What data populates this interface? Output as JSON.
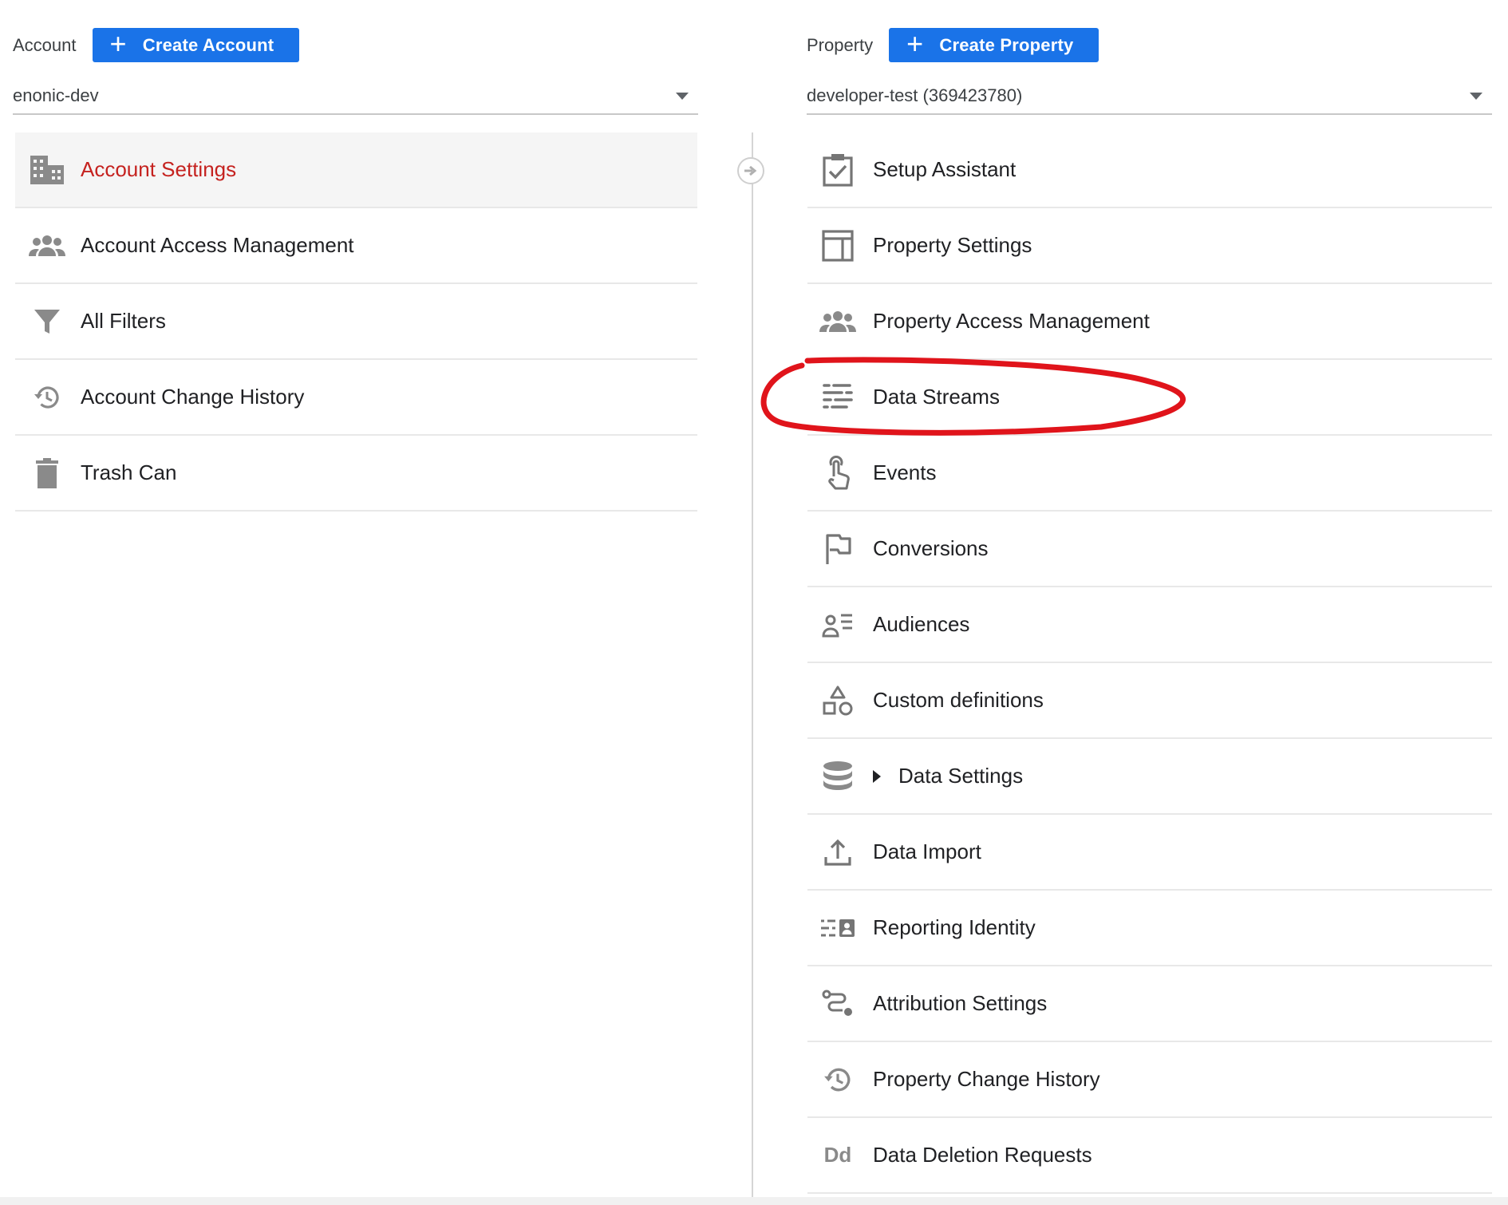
{
  "account": {
    "label": "Account",
    "create_label": "Create Account",
    "plus_glyph": "+",
    "selected": "enonic-dev"
  },
  "property": {
    "label": "Property",
    "create_label": "Create Property",
    "plus_glyph": "+",
    "selected": "developer-test (369423780)"
  },
  "account_items": [
    {
      "label": "Account Settings",
      "icon": "building-icon",
      "active": true
    },
    {
      "label": "Account Access Management",
      "icon": "people-icon"
    },
    {
      "label": "All Filters",
      "icon": "filter-icon"
    },
    {
      "label": "Account Change History",
      "icon": "history-icon"
    },
    {
      "label": "Trash Can",
      "icon": "trash-icon"
    }
  ],
  "property_items": [
    {
      "label": "Setup Assistant",
      "icon": "checklist-icon"
    },
    {
      "label": "Property Settings",
      "icon": "layout-icon"
    },
    {
      "label": "Property Access Management",
      "icon": "people-icon"
    },
    {
      "label": "Data Streams",
      "icon": "data-streams-icon",
      "annotated": true
    },
    {
      "label": "Events",
      "icon": "touch-icon"
    },
    {
      "label": "Conversions",
      "icon": "flag-icon"
    },
    {
      "label": "Audiences",
      "icon": "audience-icon"
    },
    {
      "label": "Custom definitions",
      "icon": "shapes-icon"
    },
    {
      "label": "Data Settings",
      "icon": "database-icon",
      "expandable": true
    },
    {
      "label": "Data Import",
      "icon": "upload-icon"
    },
    {
      "label": "Reporting Identity",
      "icon": "identity-icon"
    },
    {
      "label": "Attribution Settings",
      "icon": "route-icon"
    },
    {
      "label": "Property Change History",
      "icon": "history-icon"
    },
    {
      "label": "Data Deletion Requests",
      "icon": "dd-icon",
      "icon_text": "Dd"
    }
  ],
  "colors": {
    "primary_button": "#1a73e8",
    "active_text": "#c5221f",
    "annotation": "#e0141b",
    "icon": "#757575"
  }
}
